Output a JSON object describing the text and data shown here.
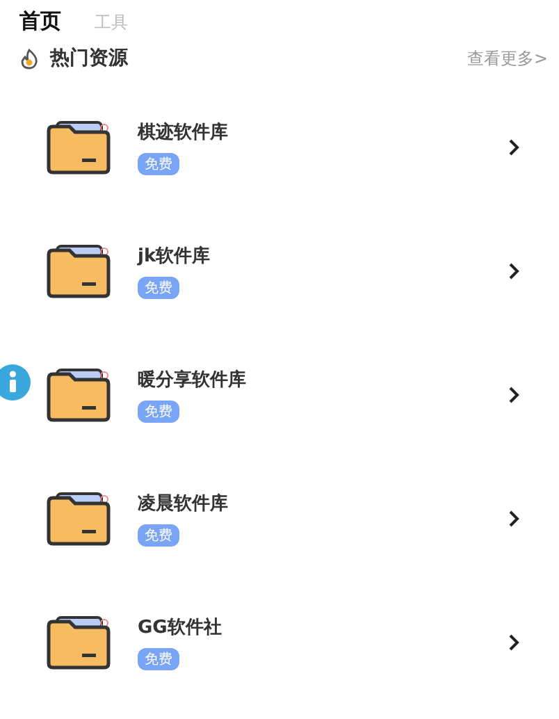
{
  "tabs": [
    {
      "label": "首页",
      "selected": true
    },
    {
      "label": "工具",
      "selected": false
    }
  ],
  "section": {
    "title": "热门资源",
    "more": "查看更多>"
  },
  "items": [
    {
      "name": "棋迹软件库",
      "badge": "免费"
    },
    {
      "name": "jk软件库",
      "badge": "免费"
    },
    {
      "name": "暖分享软件库",
      "badge": "免费"
    },
    {
      "name": "凌晨软件库",
      "badge": "免费"
    },
    {
      "name": "GG软件社",
      "badge": "免费"
    }
  ]
}
